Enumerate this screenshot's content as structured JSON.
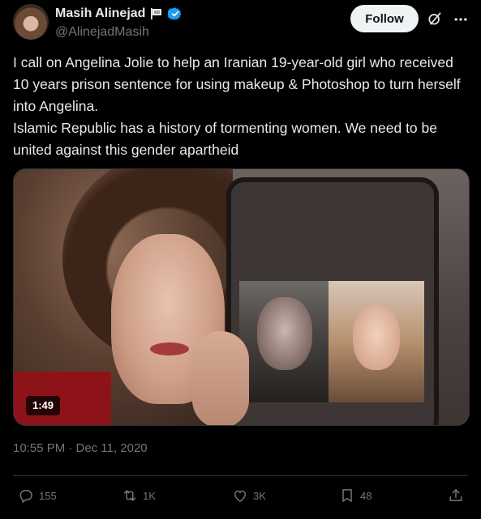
{
  "author": {
    "name": "Masih Alinejad",
    "handle": "@AlinejadMasih",
    "follow_label": "Follow"
  },
  "tweet": {
    "text": "I call on Angelina Jolie to help an Iranian 19-year-old girl who received 10 years prison sentence for using makeup & Photoshop to turn herself into Angelina.\nIslamic Republic has a history of tormenting women. We need to be united against this gender apartheid",
    "timestamp": "10:55 PM · Dec 11, 2020"
  },
  "media": {
    "duration": "1:49"
  },
  "actions": {
    "replies": "155",
    "reposts": "1K",
    "likes": "3K",
    "bookmarks": "48"
  },
  "colors": {
    "background": "#000000",
    "text": "#e7e9ea",
    "muted": "#71767b",
    "verified": "#1d9bf0"
  },
  "icons": [
    "flag-icon",
    "verified-badge-icon",
    "grok-icon",
    "more-icon",
    "reply-icon",
    "repost-icon",
    "like-icon",
    "bookmark-icon",
    "share-icon"
  ]
}
